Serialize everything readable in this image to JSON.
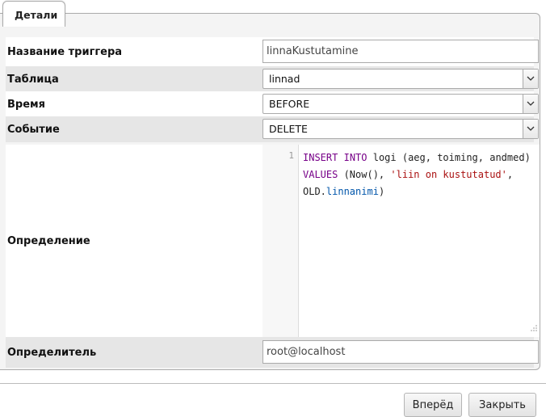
{
  "tab": {
    "label": "Детали"
  },
  "fields": {
    "trigger_name": {
      "label": "Название триггера",
      "value": "linnaKustutamine"
    },
    "table": {
      "label": "Таблица",
      "value": "linnad"
    },
    "time": {
      "label": "Время",
      "value": "BEFORE"
    },
    "event": {
      "label": "Событие",
      "value": "DELETE"
    },
    "definition": {
      "label": "Определение",
      "line_number": "1",
      "code": "INSERT INTO logi (aeg, toiming, andmed) VALUES (Now(), 'liin on kustutatud', OLD.linnanimi)"
    },
    "definer": {
      "label": "Определитель",
      "value": "root@localhost"
    }
  },
  "buttons": {
    "next": "Вперёд",
    "close": "Закрыть"
  }
}
